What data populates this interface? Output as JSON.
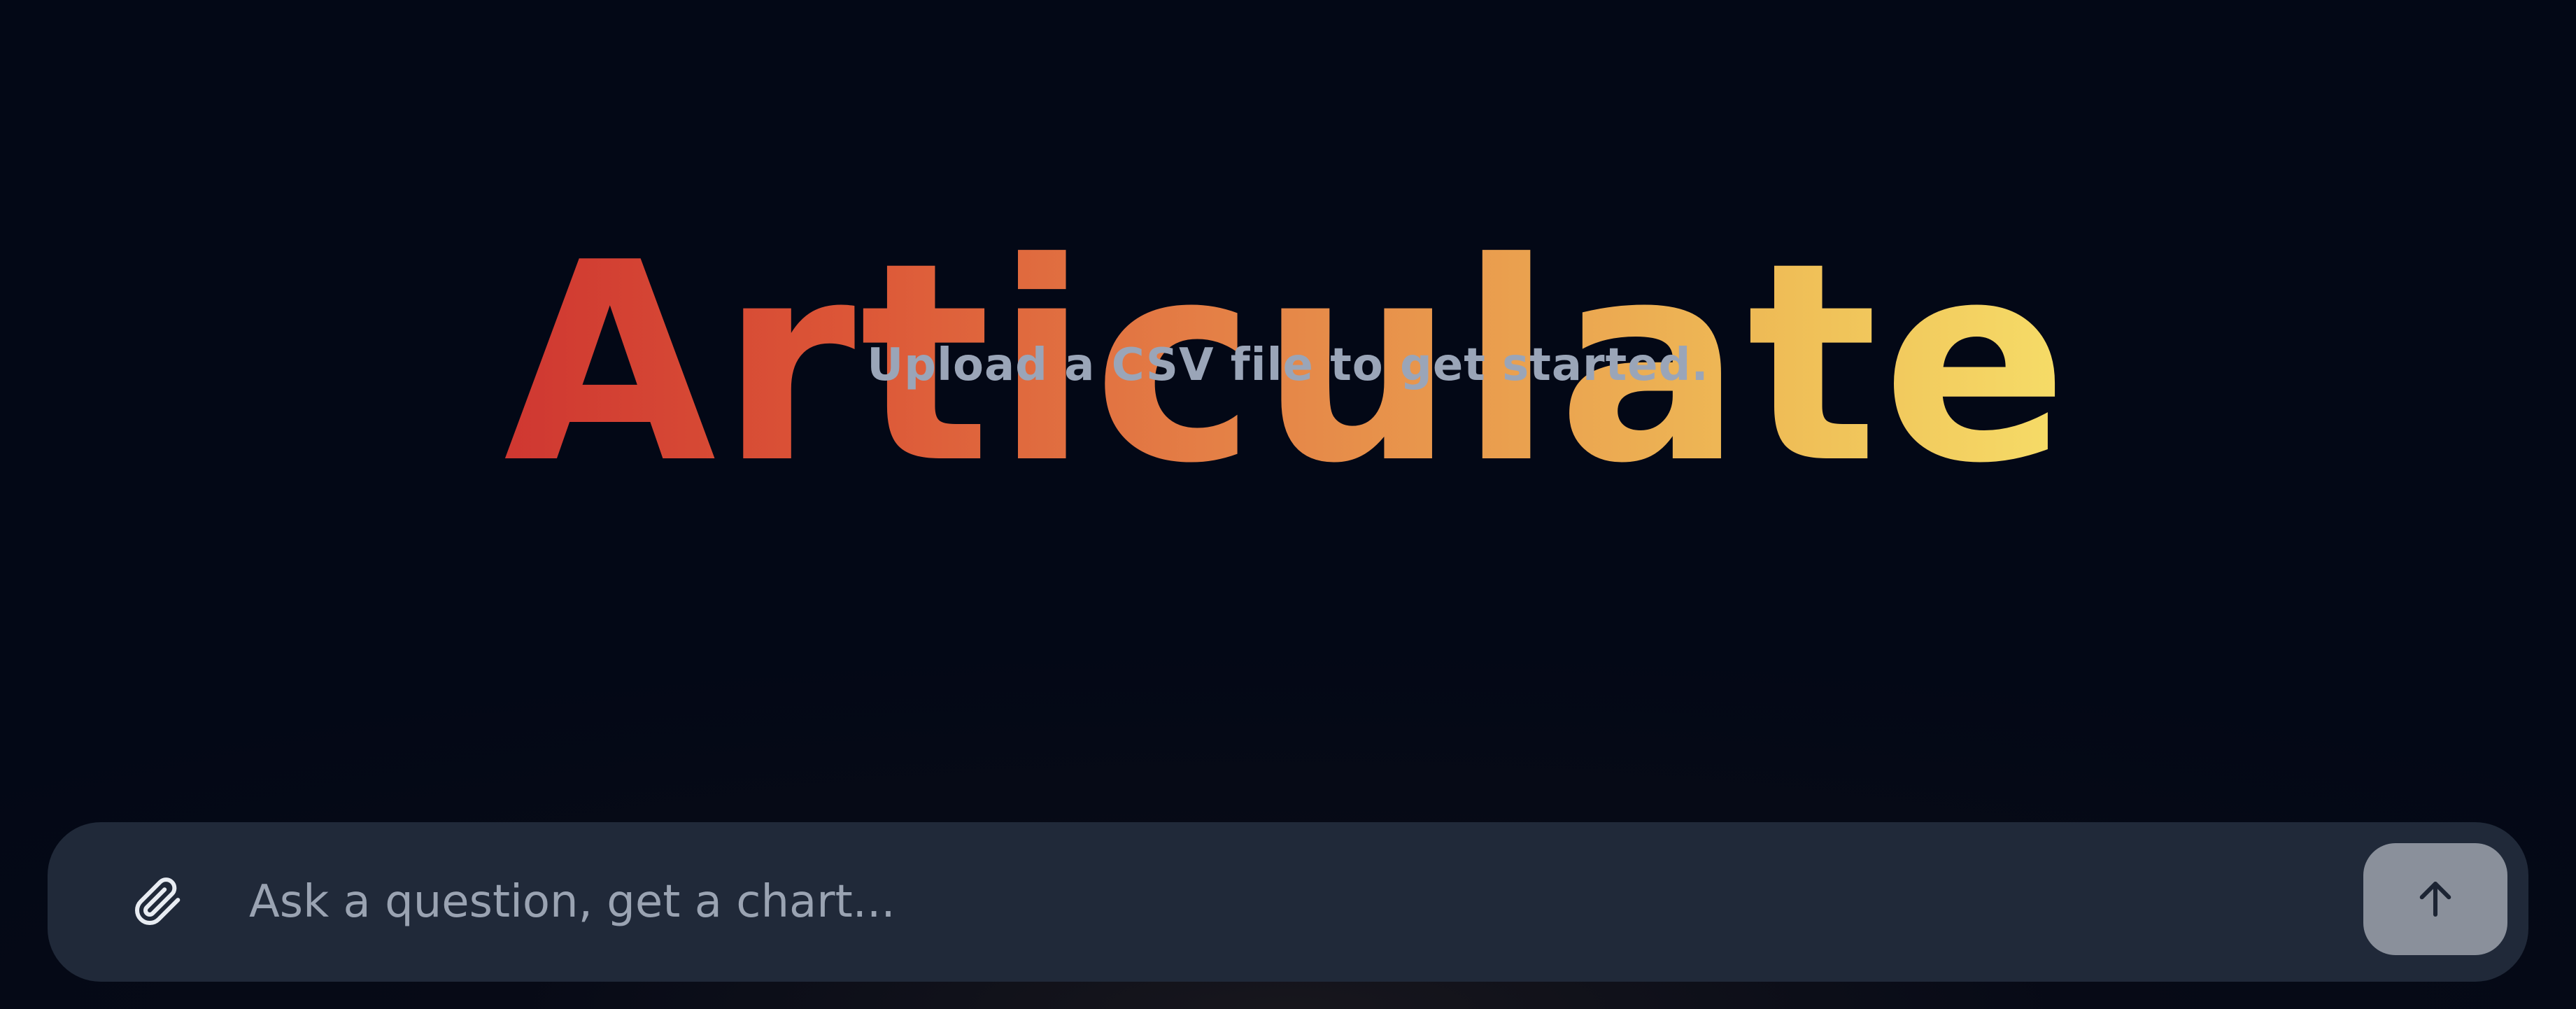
{
  "app": {
    "title": "Articulate",
    "subtitle": "Upload a CSV file to get started."
  },
  "composer": {
    "placeholder": "Ask a question, get a chart...",
    "value": "",
    "attach_icon": "paperclip-icon",
    "send_icon": "arrow-up-icon"
  },
  "colors": {
    "background": "#030816",
    "composer_background": "#202939",
    "send_button": "#8a909b",
    "subtitle": "#9aa5b8",
    "title_gradient": [
      "#cf3731",
      "#e47f46",
      "#f6dd68"
    ]
  }
}
